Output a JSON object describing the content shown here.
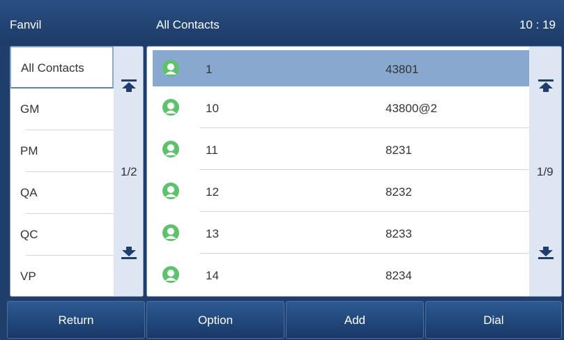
{
  "header": {
    "brand": "Fanvil",
    "title": "All Contacts",
    "time": "10 : 19"
  },
  "groups": {
    "items": [
      {
        "label": "All Contacts",
        "selected": true
      },
      {
        "label": "GM"
      },
      {
        "label": "PM"
      },
      {
        "label": "QA"
      },
      {
        "label": "QC"
      },
      {
        "label": "VP"
      }
    ],
    "page": "1/2"
  },
  "contacts": {
    "items": [
      {
        "name": "1",
        "number": "43801",
        "selected": true
      },
      {
        "name": "10",
        "number": "43800@2"
      },
      {
        "name": "11",
        "number": "8231"
      },
      {
        "name": "12",
        "number": "8232"
      },
      {
        "name": "13",
        "number": "8233"
      },
      {
        "name": "14",
        "number": "8234"
      }
    ],
    "page": "1/9"
  },
  "softkeys": {
    "return": "Return",
    "option": "Option",
    "add": "Add",
    "dial": "Dial"
  },
  "icons": {
    "avatar": "contact-avatar-icon",
    "scroll_top": "scroll-to-top-icon",
    "scroll_bottom": "scroll-to-bottom-icon"
  },
  "colors": {
    "header": "#1f3e6b",
    "selection": "#88a8cf",
    "avatar": "#5cc36a",
    "scrollbar": "#dde6f2"
  }
}
